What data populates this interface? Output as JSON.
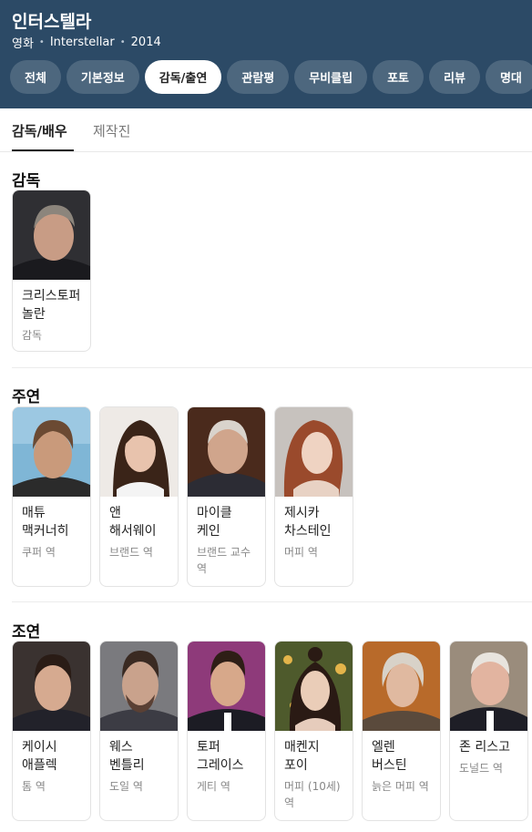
{
  "header": {
    "title": "인터스텔라",
    "category": "영화",
    "original_title": "Interstellar",
    "year": "2014",
    "tabs": [
      {
        "label": "전체"
      },
      {
        "label": "기본정보"
      },
      {
        "label": "감독/출연"
      },
      {
        "label": "관람평"
      },
      {
        "label": "무비클립"
      },
      {
        "label": "포토"
      },
      {
        "label": "리뷰"
      },
      {
        "label": "명대"
      }
    ]
  },
  "subtabs": [
    {
      "label": "감독/배우"
    },
    {
      "label": "제작진"
    }
  ],
  "sections": {
    "director": {
      "title": "감독",
      "people": [
        {
          "name": "크리스토퍼 놀란",
          "role": "감독"
        }
      ]
    },
    "lead": {
      "title": "주연",
      "people": [
        {
          "name": "매튜 맥커너히",
          "role": "쿠퍼 역"
        },
        {
          "name": "앤 해서웨이",
          "role": "브랜드 역"
        },
        {
          "name": "마이클 케인",
          "role": "브랜드 교수 역"
        },
        {
          "name": "제시카 차스테인",
          "role": "머피 역"
        }
      ]
    },
    "supporting": {
      "title": "조연",
      "people": [
        {
          "name": "케이시 애플렉",
          "role": "톰 역"
        },
        {
          "name": "웨스 벤틀리",
          "role": "도일 역"
        },
        {
          "name": "토퍼 그레이스",
          "role": "게티 역"
        },
        {
          "name": "매켄지 포이",
          "role": "머피 (10세) 역"
        },
        {
          "name": "엘렌 버스틴",
          "role": "늙은 머피 역"
        },
        {
          "name": "존 리스고",
          "role": "도널드 역"
        }
      ]
    }
  }
}
